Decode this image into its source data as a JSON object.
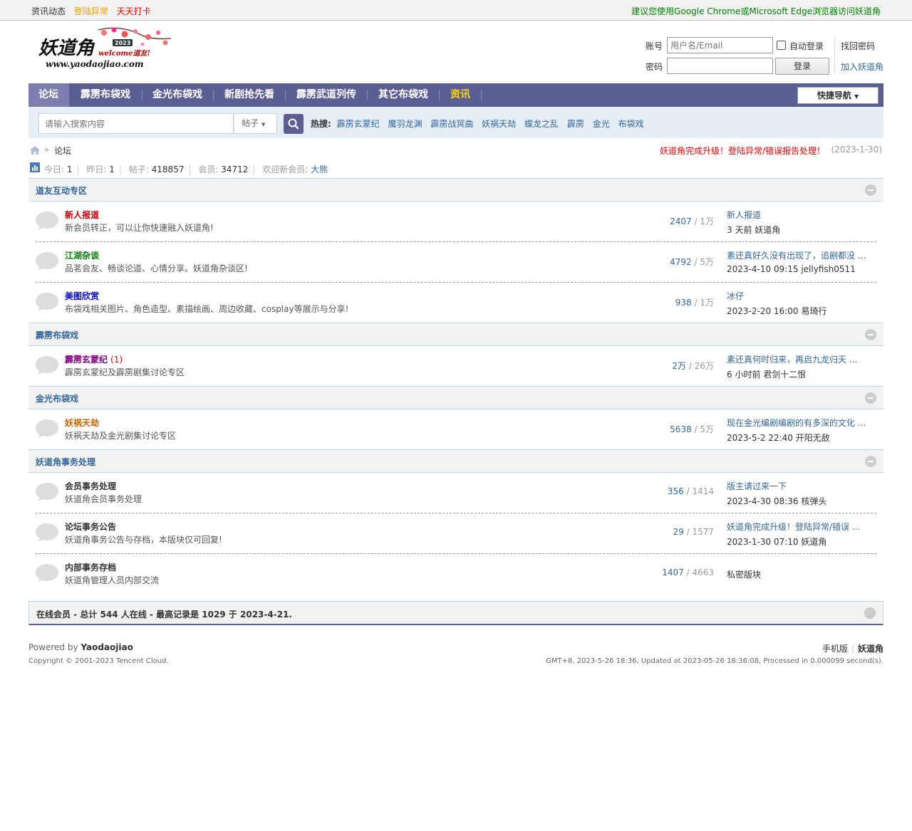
{
  "topbar": {
    "links": [
      {
        "label": "资讯动态",
        "color": "#333333"
      },
      {
        "label": "登陆异常",
        "color": "#f0a000"
      },
      {
        "label": "天天打卡",
        "color": "#e00000"
      }
    ],
    "notice": "建议您使用Google Chrome或Microsoft Edge浏览器访问妖道角"
  },
  "logo": {
    "name": "妖道角",
    "year": "2023",
    "slogan": "welcome道友!",
    "url": "www.yaodaojiao.com"
  },
  "login": {
    "account_label": "账号",
    "account_placeholder": "用户名/Email",
    "password_label": "密码",
    "auto_login": "自动登录",
    "login_button": "登录",
    "find_password": "找回密码",
    "join": "加入妖道角"
  },
  "nav": {
    "items": [
      "论坛",
      "霹雳布袋戏",
      "金光布袋戏",
      "新剧抢先看",
      "霹雳武道列传",
      "其它布袋戏",
      "资讯"
    ],
    "quick": "快捷导航"
  },
  "search": {
    "placeholder": "请输入搜索内容",
    "type": "帖子",
    "hot_label": "热搜:",
    "hot": [
      "霹雳玄蒙纪",
      "魔羽龙渊",
      "霹雳战冥曲",
      "妖祸天劫",
      "蝶龙之乱",
      "霹雳",
      "金光",
      "布袋戏"
    ]
  },
  "breadcrumb": {
    "current": "论坛",
    "notice": "妖道角完成升级！登陆异常/错误报告处理！",
    "notice_date": "(2023-1-30)"
  },
  "stats": {
    "today_label": "今日:",
    "today": "1",
    "yesterday_label": "昨日:",
    "yesterday": "1",
    "posts_label": "帖子:",
    "posts": "418857",
    "members_label": "会员:",
    "members": "34712",
    "welcome_label": "欢迎新会员:",
    "newest": "大熊"
  },
  "sections": [
    {
      "title": "道友互动专区",
      "forums": [
        {
          "name": "新人报道",
          "color": "#cc0000",
          "desc": "新会员转正，可以让你快速融入妖道角!",
          "threads": "2407",
          "posts": "1万",
          "last_title": "新人报道",
          "last_meta": "3 天前 妖道角"
        },
        {
          "name": "江湖杂谈",
          "color": "#008000",
          "desc": "品茗会友、畅谈论道、心情分享。妖道角杂谈区!",
          "threads": "4792",
          "posts": "5万",
          "last_title": "素还真好久没有出现了，追剧都没 ...",
          "last_meta": "2023-4-10 09:15 jellyfish0511"
        },
        {
          "name": "美图欣赏",
          "color": "#0000cc",
          "desc": "布袋戏相关图片、角色造型、素描绘画、周边收藏、cosplay等展示与分享!",
          "threads": "938",
          "posts": "1万",
          "last_title": "冰仔",
          "last_meta": "2023-2-20 16:00 易琦行"
        }
      ]
    },
    {
      "title": "霹雳布袋戏",
      "forums": [
        {
          "name": "霹雳玄蒙纪",
          "color": "#800080",
          "count": "(1)",
          "desc": "霹雳玄蒙纪及霹雳剧集讨论专区",
          "threads": "2万",
          "posts": "26万",
          "last_title": "素还真何时归来，再启九龙归天 ...",
          "last_meta": "6 小时前 君剑十二恨"
        }
      ]
    },
    {
      "title": "金光布袋戏",
      "forums": [
        {
          "name": "妖祸天劫",
          "color": "#cc6600",
          "desc": "妖祸天劫及金光剧集讨论专区",
          "threads": "5638",
          "posts": "5万",
          "last_title": "现在金光编剧编剧的有多深的文化 ...",
          "last_meta": "2023-5-2 22:40 开阳无敌"
        }
      ]
    },
    {
      "title": "妖道角事务处理",
      "forums": [
        {
          "name": "会员事务处理",
          "color": "#333333",
          "desc": "妖道角会员事务处理",
          "threads": "356",
          "posts": "1414",
          "last_title": "版主请过来一下",
          "last_meta": "2023-4-30 08:36 核弹头"
        },
        {
          "name": "论坛事务公告",
          "color": "#333333",
          "desc": "妖道角事务公告与存档，本版块仅可回复!",
          "threads": "29",
          "posts": "1577",
          "last_title": "妖道角完成升级！登陆异常/错误 ...",
          "last_meta": "2023-1-30 07:10 妖道角"
        },
        {
          "name": "内部事务存档",
          "color": "#333333",
          "desc": "妖道角管理人员内部交流",
          "threads": "1407",
          "posts": "4663",
          "private": "私密版块"
        }
      ]
    }
  ],
  "online": "在线会员 - 总计 544 人在线 - 最高记录是 1029 于 2023-4-21.",
  "footer": {
    "powered_label": "Powered by",
    "powered": "Yaodaojiao",
    "copyright": "Copyright © 2001-2023 Tencent Cloud.",
    "mobile": "手机版",
    "site": "妖道角",
    "gmt": "GMT+8, 2023-5-26 18:36, Updated at 2023-05-26 18:36:08, Processed in 0.000099 second(s)."
  }
}
